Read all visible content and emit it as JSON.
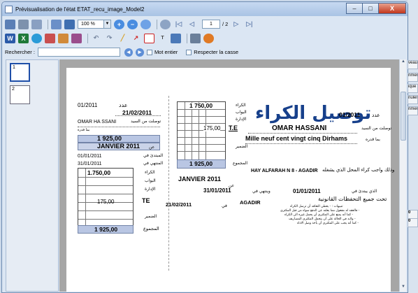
{
  "window": {
    "title": "Prévisualisation de l'état ETAT_recu_image_Model2",
    "min_glyph": "‒",
    "max_glyph": "□",
    "close_glyph": "X"
  },
  "toolbar": {
    "zoom_value": "100 %",
    "page_current": "1",
    "page_total": "/ 2",
    "zoom_dropdown_glyph": "▼"
  },
  "search": {
    "label": "Rechercher :",
    "value": "",
    "whole_word_label": "Mot entier",
    "match_case_label": "Respecter la casse"
  },
  "thumbnails": [
    "1",
    "2"
  ],
  "right_edge": {
    "tabs": [
      "veau",
      "rimer",
      "ique",
      "nuler",
      "rimer"
    ],
    "numbers": [
      "0",
      "0"
    ]
  },
  "receipt": {
    "stub": {
      "date": "01/2011",
      "date_label": "عدد",
      "issue_date": "21/02/2011",
      "name": "OMAR HA SSANI",
      "name_label": "توصلت من السيد",
      "amount_label": "بما قدره",
      "amount": "1 925,00",
      "month": "JANVIER 2011",
      "month_label": "عن",
      "from_date": "01/01/2011",
      "from_label": "المبتدئ في",
      "to_date": "31/01/2011",
      "to_label": "المنتهي في",
      "rent": "1.750,00",
      "rent_label": "الكراء",
      "door_label": "البواب",
      "admin_label": "الإدارة",
      "tax": "175,00",
      "tax_code": "TE",
      "total_label": "المجموع",
      "other_label": "الضمير",
      "total": "1 925,00"
    },
    "main": {
      "title": "توصيل الكراء",
      "number": "01/2011",
      "number_label": "عدد",
      "tenant_label": "توصلت من السيد",
      "tenant": "OMAR HASSANI",
      "amount_label": "بما قدره",
      "amount_words": "Mille neuf cent vingt cinq Dirhams",
      "rent": "1 750,00",
      "rent_label": "الكراء",
      "door_label": "البواب",
      "admin_label": "الإدارة",
      "tax": "175,00",
      "tax_code": "T.E",
      "tax_label": "الضمير",
      "total": "1 925,00",
      "total_label": "المجموع",
      "property_label": "وذلك واجب كراء المحل الذي يشغله",
      "property": "HAY ALFARAH  N 8 - AGADIR",
      "period_label": "عن",
      "period": "JANVIER 2011",
      "start_label": "الذي يبتدئ في",
      "start": "01/01/2011",
      "end_label": "وينتهي في",
      "end": "31/01/2011",
      "reserve_text": "تحت جميع التحفظات القانونية",
      "date": "21/02/2011",
      "at_label": "في",
      "city": "AGADIR",
      "notes": [
        "تنبيهات : - يعطي التعاقد أن ترسل الكراء",
        "- فالعقد له مفعول مما يعلنه عن الدفع سواء من قبل المكتري",
        "- كما أنه يمنع على المكتري أن يحمل غيره الى الكراء",
        "- ولابد في الحالة على أن يتحمل المكتري المصاريف",
        "- كما أنه يجب على المكتري أن يأخذ وصل الاداء"
      ]
    }
  }
}
